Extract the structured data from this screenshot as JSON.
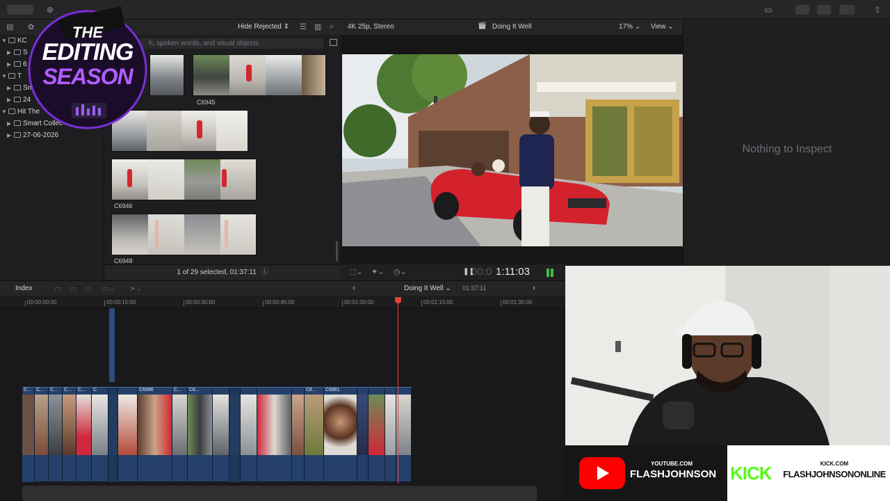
{
  "toolbar": {
    "filter_label": "Hide Rejected",
    "search_placeholder": "h, spoken words, and visual objects",
    "format_label": "4K 25p, Stereo",
    "project_name": "Doing It Well",
    "zoom_label": "17%",
    "view_label": "View"
  },
  "sidebar": {
    "items": [
      {
        "label": "KC",
        "indent": 0,
        "expanded": true
      },
      {
        "label": "S",
        "indent": 1,
        "expanded": false
      },
      {
        "label": "6",
        "indent": 1,
        "expanded": false
      },
      {
        "label": "T",
        "indent": 0,
        "expanded": true
      },
      {
        "label": "Sn",
        "indent": 1,
        "expanded": false
      },
      {
        "label": "24",
        "indent": 1,
        "expanded": false
      },
      {
        "label": "Hit The",
        "indent": 0,
        "expanded": true
      },
      {
        "label": "Smart Collec",
        "indent": 1,
        "expanded": false
      },
      {
        "label": "27-06-2026",
        "indent": 1,
        "expanded": false
      }
    ]
  },
  "browser": {
    "clips": [
      {
        "name": "C6945"
      },
      {
        "name": ""
      },
      {
        "name": "C6946"
      },
      {
        "name": "C6948"
      }
    ],
    "footer": "1 of 29 selected, 01:37:11"
  },
  "inspector": {
    "empty_text": "Nothing to Inspect"
  },
  "viewer": {
    "timecode_dim": "00:0",
    "timecode": "1:11:03"
  },
  "timeline": {
    "index_label": "Index",
    "project_name": "Doing It Well",
    "duration": "01:37:11",
    "ruler": [
      "00:00:00:00",
      "00:00:15:00",
      "00:00:30:00",
      "00:00:45:00",
      "00:01:00:00",
      "00:01:15:00",
      "00:01:30:00"
    ],
    "clip_labels": [
      "C...",
      "C...",
      "C...",
      "C...",
      "C...",
      "C",
      "C6896",
      "C...",
      "C6...",
      "C6...",
      "C6861"
    ]
  },
  "logo": {
    "line1": "THE",
    "line2": "EDITING",
    "line3": "SEASON"
  },
  "social": {
    "youtube_site": "YOUTUBE.COM",
    "youtube_handle": "FLASHJOHNSON",
    "kick_logo": "KICK",
    "kick_site": "KICK.COM",
    "kick_handle": "FLASHJOHNSONONLINE"
  },
  "colors": {
    "accent_red": "#e0453a",
    "clip_blue": "#24406a",
    "kick_green": "#53fc18",
    "youtube_red": "#ff0000"
  }
}
